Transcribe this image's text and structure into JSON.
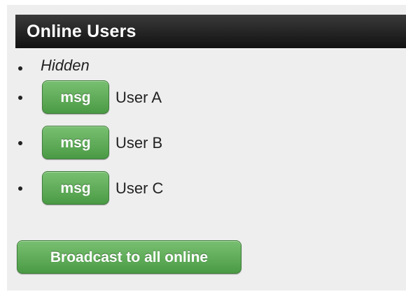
{
  "panel": {
    "title": "Online Users"
  },
  "users": {
    "hidden_label": "Hidden",
    "msg_label": "msg",
    "items": [
      {
        "name": "User A"
      },
      {
        "name": "User B"
      },
      {
        "name": "User C"
      }
    ]
  },
  "actions": {
    "broadcast_label": "Broadcast to all online"
  },
  "colors": {
    "header_bg": "#1a1a1a",
    "panel_bg": "#eeeeee",
    "button_green": "#5aa653"
  }
}
